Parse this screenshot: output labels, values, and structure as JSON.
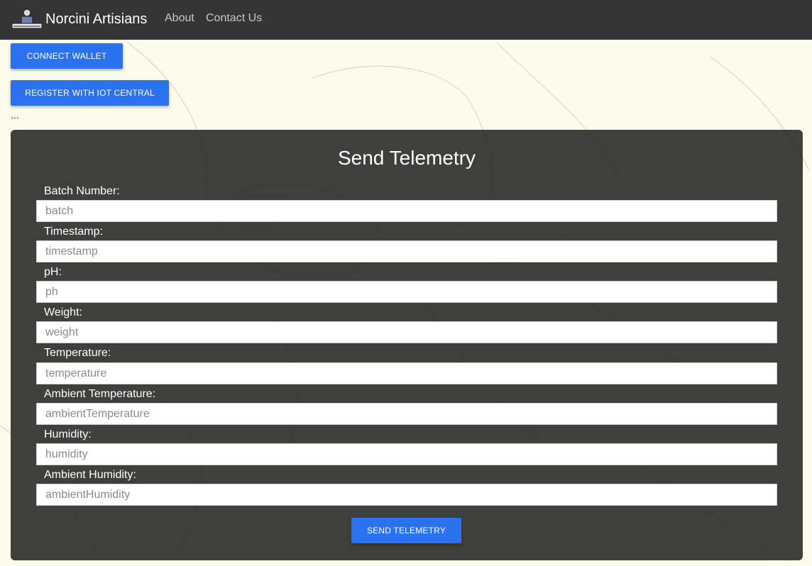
{
  "nav": {
    "brand": "Norcini Artisians",
    "links": [
      "About",
      "Contact Us"
    ]
  },
  "actions": {
    "connect_wallet": "CONNECT WALLET",
    "register_iot": "REGISTER WITH IOT CENTRAL",
    "status": "..."
  },
  "form": {
    "title": "Send Telemetry",
    "fields": [
      {
        "label": "Batch Number:",
        "placeholder": "batch"
      },
      {
        "label": "Timestamp:",
        "placeholder": "timestamp"
      },
      {
        "label": "pH:",
        "placeholder": "ph"
      },
      {
        "label": "Weight:",
        "placeholder": "weight"
      },
      {
        "label": "Temperature:",
        "placeholder": "temperature"
      },
      {
        "label": "Ambient Temperature:",
        "placeholder": "ambientTemperature"
      },
      {
        "label": "Humidity:",
        "placeholder": "humidity"
      },
      {
        "label": "Ambient Humidity:",
        "placeholder": "ambientHumidity"
      }
    ],
    "submit": "SEND TELEMETRY"
  },
  "colors": {
    "navbar": "#353535",
    "accent": "#2a72f0",
    "panel": "#2a2a2a",
    "page_background": "#fbfcec"
  },
  "icons": [
    "logo-icon"
  ]
}
